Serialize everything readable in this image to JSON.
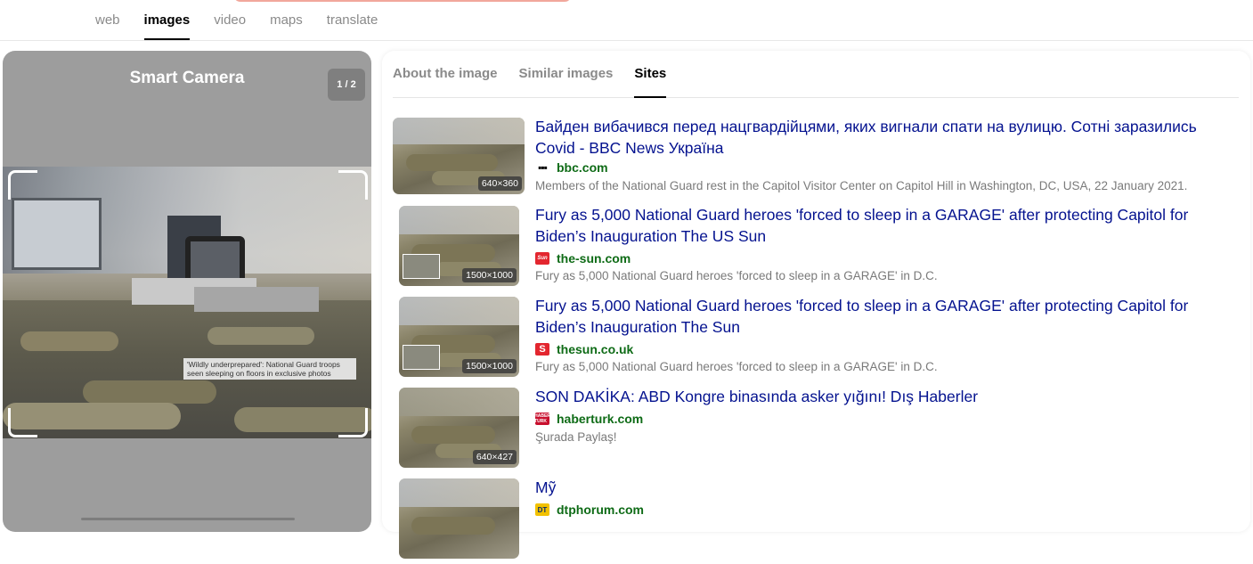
{
  "nav": {
    "tabs": [
      {
        "label": "web",
        "active": false
      },
      {
        "label": "images",
        "active": true
      },
      {
        "label": "video",
        "active": false
      },
      {
        "label": "maps",
        "active": false
      },
      {
        "label": "translate",
        "active": false
      }
    ]
  },
  "camera": {
    "title": "Smart Camera",
    "counter": "1 / 2",
    "caption": "'Wildly underprepared': National Guard troops seen sleeping on floors in exclusive photos"
  },
  "results_tabs": [
    {
      "label": "About the image",
      "active": false
    },
    {
      "label": "Similar images",
      "active": false
    },
    {
      "label": "Sites",
      "active": true
    }
  ],
  "results": [
    {
      "size": "640×360",
      "title": "Байден вибачився перед нацгвардійцями, яких вигнали спати на вулицю. Сотні заразились Covid - BBC News Україна",
      "site": "bbc.com",
      "favicon": "bbc-icon",
      "description": "Members of the National Guard rest in the Capitol Visitor Center on Capitol Hill in Washington, DC, USA, 22 January 2021."
    },
    {
      "size": "1500×1000",
      "title": "Fury as 5,000 National Guard heroes 'forced to sleep in a GARAGE' after protecting Capitol for Biden’s Inauguration The US Sun",
      "site": "the-sun.com",
      "favicon": "sun-icon",
      "description": "Fury as 5,000 National Guard heroes 'forced to sleep in a GARAGE' in D.C."
    },
    {
      "size": "1500×1000",
      "title": "Fury as 5,000 National Guard heroes 'forced to sleep in a GARAGE' after protecting Capitol for Biden’s Inauguration The Sun",
      "site": "thesun.co.uk",
      "favicon": "thesun-icon",
      "description": "Fury as 5,000 National Guard heroes 'forced to sleep in a GARAGE' in D.C."
    },
    {
      "size": "640×427",
      "title": "SON DAKİKA: ABD Kongre binasında asker yığını! Dış Haberler",
      "site": "haberturk.com",
      "favicon": "haberturk-icon",
      "description": "Şurada Paylaş!"
    },
    {
      "size": "",
      "title": "Mỹ",
      "site": "dtphorum.com",
      "favicon": "dt-icon",
      "description": ""
    }
  ],
  "favicon_text": {
    "bbc": "▪▪▪",
    "sun": "Sun",
    "thesun": "S",
    "haberturk": "HABER TURK",
    "dt": "DT"
  }
}
